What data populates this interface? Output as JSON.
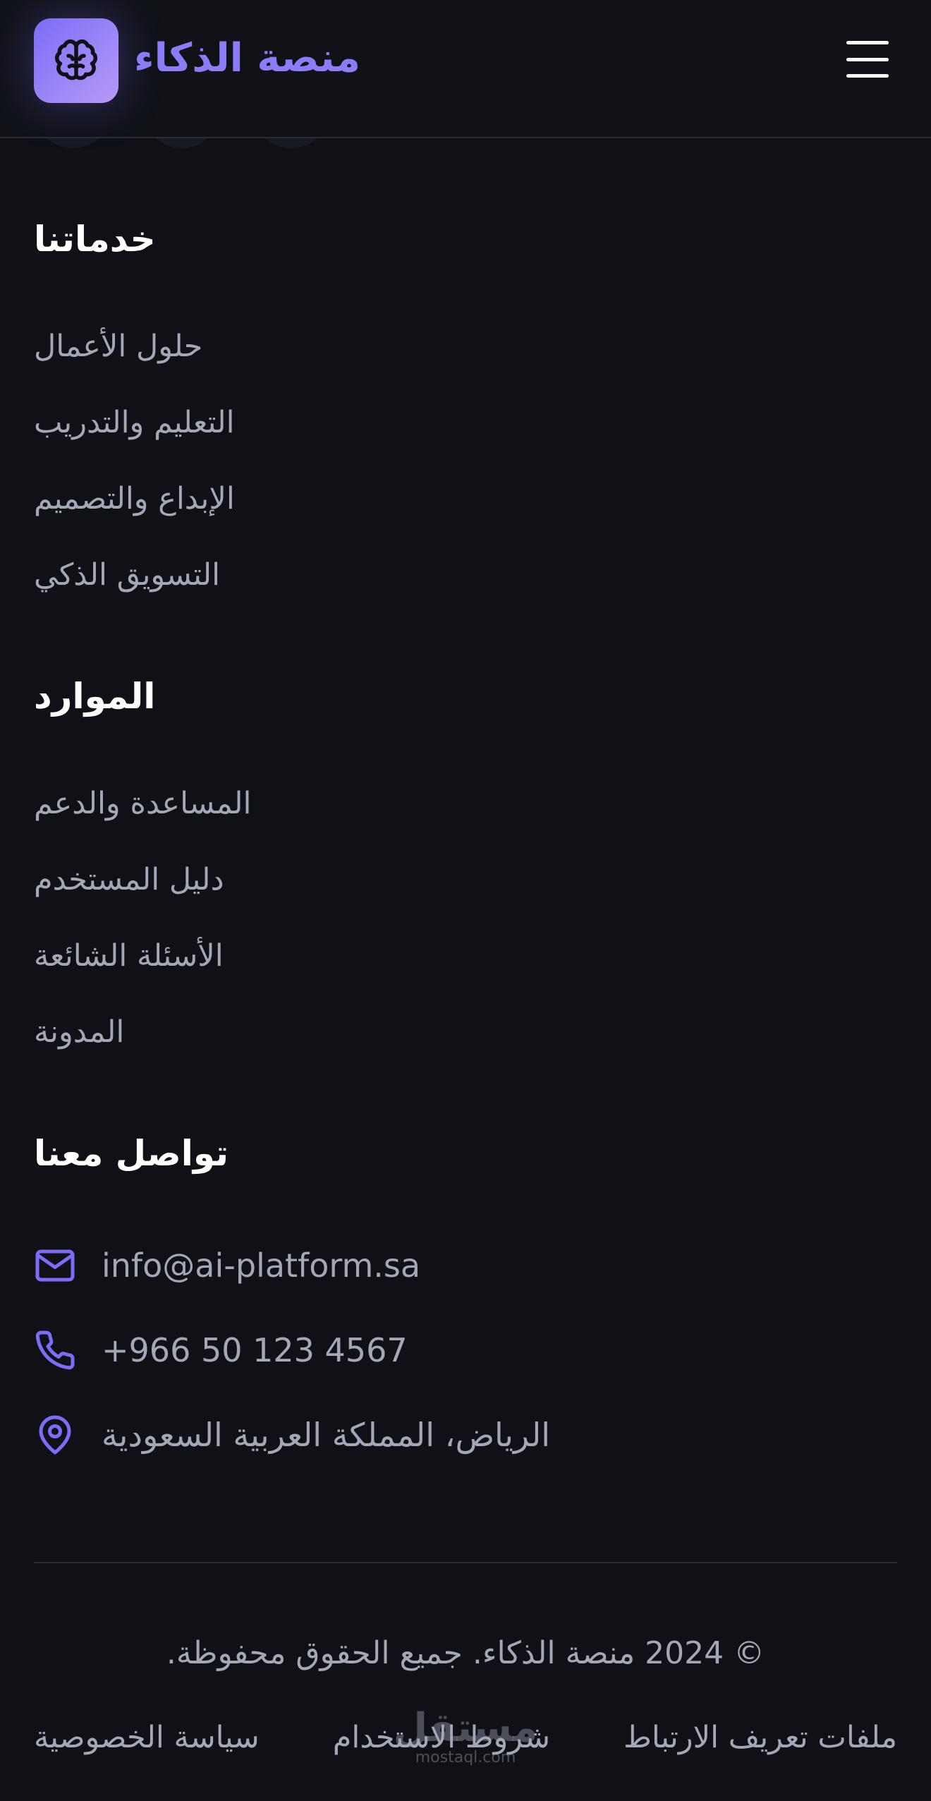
{
  "header": {
    "brand": "منصة الذكاء",
    "logo_icon": "brain-icon",
    "menu_icon": "hamburger-menu-icon",
    "accent_color": "#8b7cf8"
  },
  "services": {
    "title": "خدماتنا",
    "links": [
      "حلول الأعمال",
      "التعليم والتدريب",
      "الإبداع والتصميم",
      "التسويق الذكي"
    ]
  },
  "resources": {
    "title": "الموارد",
    "links": [
      "المساعدة والدعم",
      "دليل المستخدم",
      "الأسئلة الشائعة",
      "المدونة"
    ]
  },
  "contact": {
    "title": "تواصل معنا",
    "email": "info@ai-platform.sa",
    "phone": "+966 50 123 4567",
    "address": "الرياض، المملكة العربية السعودية"
  },
  "footer": {
    "copyright": "© 2024 منصة الذكاء. جميع الحقوق محفوظة.",
    "links": [
      "ملفات تعريف الارتباط",
      "شروط الاستخدام",
      "سياسة الخصوصية"
    ]
  },
  "watermark": {
    "main": "مستقل",
    "sub": "mostaql.com"
  }
}
